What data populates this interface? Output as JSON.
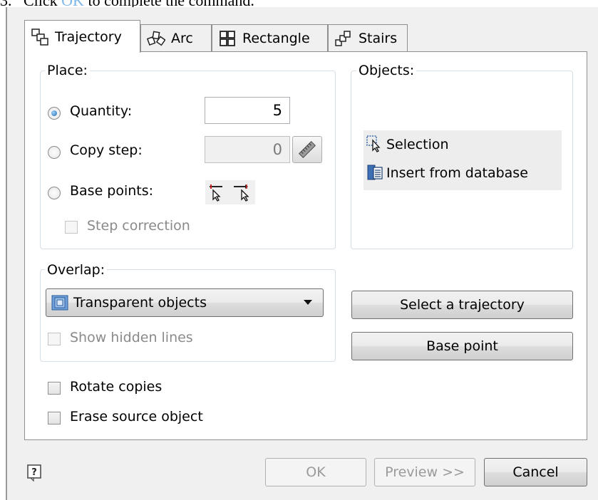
{
  "caption": {
    "step": "3.",
    "text_before": "Click",
    "ok_word": "OK",
    "text_after": "to complete the command."
  },
  "tabs": [
    {
      "label": "Trajectory",
      "icon": "trajectory-icon",
      "active": true
    },
    {
      "label": "Arc",
      "icon": "arc-icon",
      "active": false
    },
    {
      "label": "Rectangle",
      "icon": "rectangle-grid-icon",
      "active": false
    },
    {
      "label": "Stairs",
      "icon": "stairs-icon",
      "active": false
    }
  ],
  "place": {
    "title": "Place:",
    "quantity_label": "Quantity:",
    "quantity_value": "5",
    "copy_step_label": "Copy step:",
    "copy_step_value": "0",
    "base_points_label": "Base points:",
    "step_correction_label": "Step correction"
  },
  "objects": {
    "title": "Objects:",
    "selection_label": "Selection",
    "insert_label": "Insert from database"
  },
  "overlap": {
    "title": "Overlap:",
    "selected": "Transparent objects",
    "show_hidden_label": "Show hidden lines"
  },
  "buttons": {
    "select_trajectory": "Select a trajectory",
    "base_point": "Base point",
    "ok": "OK",
    "preview": "Preview >>",
    "cancel": "Cancel"
  },
  "options": {
    "rotate_copies": "Rotate copies",
    "erase_source": "Erase source object"
  },
  "colors": {
    "dialog_bg": "#f0f0f0",
    "panel_bg": "#ffffff",
    "accent": "#1f6ab8",
    "caption_highlight": "#7fb6e6"
  }
}
